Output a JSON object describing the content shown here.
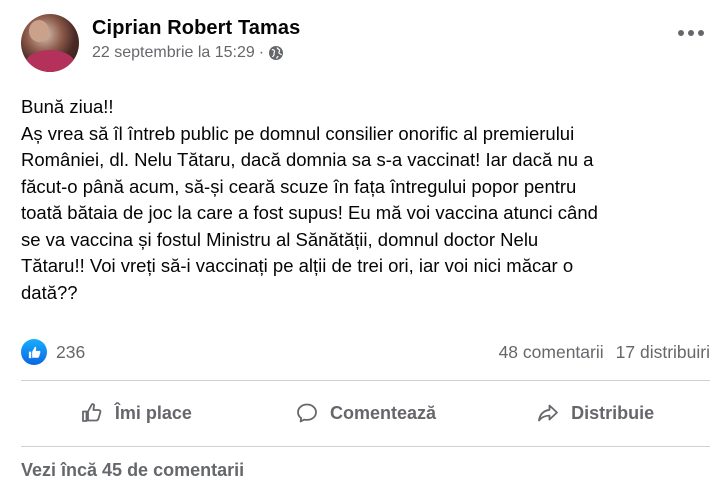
{
  "post": {
    "author": "Ciprian Robert Tamas",
    "timestamp": "22 septembrie la 15:29",
    "separator": "·",
    "privacy_icon": "globe-icon",
    "more_icon": "more-options-icon",
    "lines": [
      "Bună ziua!!",
      "Aș vrea să îl întreb public pe domnul consilier onorific al premierului",
      "României, dl. Nelu Tătaru, dacă domnia sa s-a vaccinat! Iar dacă nu a",
      "făcut-o până acum, să-și ceară scuze în fața întregului popor pentru",
      "toată bătaia de joc la care a fost supus! Eu mă voi vaccina atunci când",
      "se va vaccina și fostul Ministru al Sănătății, domnul doctor Nelu",
      "Tătaru!! Voi vreți să-i vaccinați pe alții de trei ori, iar voi nici măcar o",
      "dată??"
    ]
  },
  "stats": {
    "reaction_icon": "like-reaction-icon",
    "reactions": "236",
    "comments": "48 comentarii",
    "shares": "17 distribuiri"
  },
  "actions": {
    "like": "Îmi place",
    "comment": "Comentează",
    "share": "Distribuie"
  },
  "footer": {
    "view_more": "Vezi încă 45 de comentarii"
  },
  "colors": {
    "text": "#050505",
    "muted": "#65676b",
    "like_blue": "#1877f2",
    "divider": "#ced0d4"
  }
}
